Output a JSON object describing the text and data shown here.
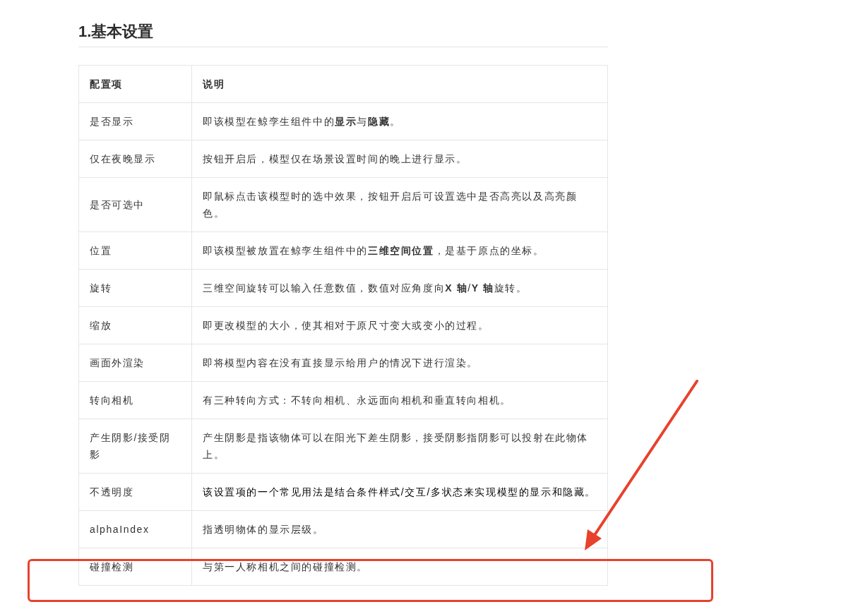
{
  "heading": "1.基本设置",
  "table": {
    "columns": [
      "配置项",
      "说明"
    ],
    "rows": [
      {
        "item": "是否显示",
        "desc": "即该模型在鲸孪生组件中的**显示**与**隐藏**。",
        "emphasis": false
      },
      {
        "item": "仅在夜晚显示",
        "desc": "按钮开启后，模型仅在场景设置时间的晚上进行显示。",
        "emphasis": false
      },
      {
        "item": "是否可选中",
        "desc": "即鼠标点击该模型时的选中效果，按钮开启后可设置选中是否高亮以及高亮颜色。",
        "emphasis": false
      },
      {
        "item": "位置",
        "desc": "即该模型被放置在鲸孪生组件中的**三维空间位置**，是基于原点的坐标。",
        "emphasis": false
      },
      {
        "item": "旋转",
        "desc": "三维空间旋转可以输入任意数值，数值对应角度向**X 轴**/**Y 轴**旋转。",
        "emphasis": false
      },
      {
        "item": "缩放",
        "desc": "即更改模型的大小，使其相对于原尺寸变大或变小的过程。",
        "emphasis": false
      },
      {
        "item": "画面外渲染",
        "desc": "即将模型内容在没有直接显示给用户的情况下进行渲染。",
        "emphasis": false
      },
      {
        "item": "转向相机",
        "desc": "有三种转向方式：不转向相机、永远面向相机和垂直转向相机。",
        "emphasis": false
      },
      {
        "item": "产生阴影/接受阴影",
        "desc": "产生阴影是指该物体可以在阳光下差生阴影，接受阴影指阴影可以投射在此物体上。",
        "emphasis": false
      },
      {
        "item": "不透明度",
        "desc": "该设置项的一个常见用法是结合条件样式/交互/多状态来实现模型的显示和隐藏。",
        "emphasis": true
      },
      {
        "item": "alphaIndex",
        "desc": "指透明物体的显示层级。",
        "emphasis": false
      },
      {
        "item": "碰撞检测",
        "desc": "与第一人称相机之间的碰撞检测。",
        "emphasis": false
      }
    ]
  }
}
